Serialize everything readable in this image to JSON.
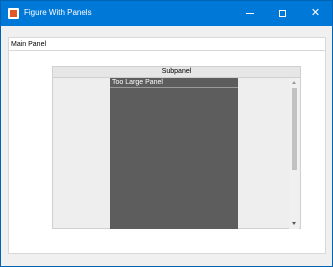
{
  "window": {
    "title": "Figure With Panels",
    "controls": {
      "minimize": "minimize-icon",
      "maximize": "maximize-icon",
      "close": "close-icon"
    }
  },
  "main_panel": {
    "label": "Main Panel"
  },
  "subpanel": {
    "label": "Subpanel"
  },
  "too_large_panel": {
    "label": "Too Large Panel"
  },
  "scrollbar": {
    "position": 0
  },
  "colors": {
    "titlebar": "#0078d7",
    "panel_dark": "#5d5d5d",
    "window_bg": "#f0f0f0"
  }
}
